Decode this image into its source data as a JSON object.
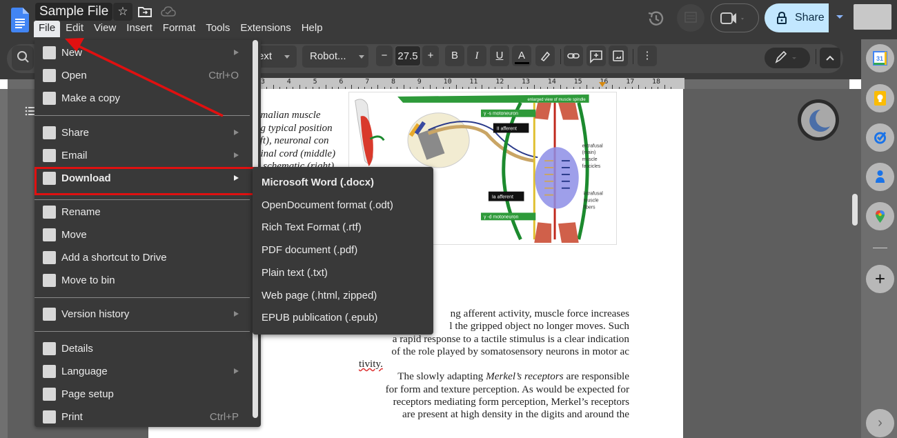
{
  "app": {
    "document_title": "Sample File",
    "menubar": [
      "File",
      "Edit",
      "View",
      "Insert",
      "Format",
      "Tools",
      "Extensions",
      "Help"
    ],
    "active_menu": "File",
    "share_label": "Share"
  },
  "toolbar": {
    "style_label": "ext",
    "font_label": "Robot...",
    "font_size": "27.5",
    "decrease_label": "−",
    "increase_label": "+",
    "bold": "B",
    "italic": "I",
    "underline": "U",
    "text_color": "A",
    "more": "⋮",
    "collapse": "^"
  },
  "ruler": {
    "numbers": [
      "3",
      "4",
      "5",
      "6",
      "7",
      "8",
      "9",
      "10",
      "11",
      "12",
      "13",
      "14",
      "15",
      "16",
      "17",
      "18"
    ]
  },
  "file_menu": {
    "items": [
      {
        "label": "New",
        "icon": "new-doc-icon",
        "submenu": true
      },
      {
        "label": "Open",
        "icon": "folder-icon",
        "shortcut": "Ctrl+O"
      },
      {
        "label": "Make a copy",
        "icon": "copy-icon"
      },
      {
        "label": "Share",
        "icon": "person-add-icon",
        "submenu": true
      },
      {
        "label": "Email",
        "icon": "email-icon",
        "submenu": true
      },
      {
        "label": "Download",
        "icon": "download-icon",
        "submenu": true,
        "highlighted": true
      },
      {
        "label": "Rename",
        "icon": "rename-icon"
      },
      {
        "label": "Move",
        "icon": "move-folder-icon"
      },
      {
        "label": "Add a shortcut to Drive",
        "icon": "drive-shortcut-icon"
      },
      {
        "label": "Move to bin",
        "icon": "trash-icon"
      },
      {
        "label": "Version history",
        "icon": "history-icon",
        "submenu": true
      },
      {
        "label": "Details",
        "icon": "info-icon"
      },
      {
        "label": "Language",
        "icon": "globe-icon",
        "submenu": true
      },
      {
        "label": "Page setup",
        "icon": "page-setup-icon"
      },
      {
        "label": "Print",
        "icon": "print-icon",
        "shortcut": "Ctrl+P"
      }
    ]
  },
  "download_submenu": {
    "items": [
      "Microsoft Word (.docx)",
      "OpenDocument format (.odt)",
      "Rich Text Format (.rtf)",
      "PDF document (.pdf)",
      "Plain text (.txt)",
      "Web page (.html, zipped)",
      "EPUB publication (.epub)"
    ]
  },
  "document": {
    "caption_lines": [
      "nmalian muscle",
      "ng typical position",
      "eft), neuronal con",
      "pinal cord (middle)",
      "d schematic (right)"
    ],
    "figure_labels": {
      "banner": "enlarged view of muscle spindle",
      "gamma_s": "γ -s motoneuron",
      "ii_afferent": "II afferent",
      "ia_afferent": "Ia afferent",
      "gamma_d": "γ -d motoneuron",
      "extrafusal": [
        "extrafusal",
        "(main)",
        "muscle",
        "fascicles"
      ],
      "intrafusal": [
        "intrafusal",
        "muscle",
        "fibers"
      ]
    },
    "body_lines": [
      "ng afferent activity, muscle force increases",
      "l the gripped object no longer moves. Such",
      "a rapid response to a tactile stimulus is a clear indication",
      "of the role played by somatosensory neurons in motor ac",
      "tivity.",
      "The slowly adapting ",
      "for form and texture perception. As would be expected for",
      "receptors mediating form perception, Merkel’s receptors",
      "are present at high density in the digits and around the"
    ],
    "body_italic": "Merkel’s receptors",
    "body_line6_tail": " are responsible"
  },
  "side_panel": {
    "apps": [
      "calendar-icon",
      "keep-icon",
      "tasks-icon",
      "contacts-icon",
      "maps-icon"
    ],
    "calendar_day": "31",
    "add_label": "+",
    "expand_label": "›"
  },
  "colors": {
    "accent_red": "#e01010",
    "share_bg": "#c2e7ff",
    "docs_blue": "#4285f4",
    "menu_bg": "#393939"
  }
}
